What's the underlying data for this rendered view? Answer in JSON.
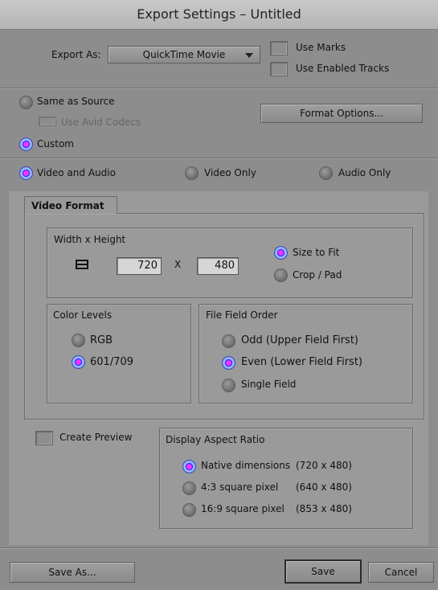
{
  "window": {
    "title": "Export Settings – Untitled"
  },
  "export": {
    "label": "Export As:",
    "format_value": "QuickTime Movie",
    "use_marks": "Use Marks",
    "use_enabled_tracks": "Use Enabled Tracks"
  },
  "source": {
    "same_as_source": "Same as Source",
    "use_avid_codecs": "Use Avid Codecs",
    "custom": "Custom",
    "format_options_button": "Format Options..."
  },
  "media_type": {
    "video_and_audio": "Video and Audio",
    "video_only": "Video Only",
    "audio_only": "Audio Only"
  },
  "tabs": {
    "video_format": "Video Format"
  },
  "size": {
    "section_title": "Width x Height",
    "width": "720",
    "x_label": "X",
    "height": "480",
    "size_to_fit": "Size to Fit",
    "crop_pad": "Crop / Pad"
  },
  "color_levels": {
    "title": "Color Levels",
    "rgb": "RGB",
    "601_709": "601/709"
  },
  "field_order": {
    "title": "File Field Order",
    "odd": "Odd (Upper Field First)",
    "even": "Even (Lower Field First)",
    "single": "Single Field"
  },
  "preview": {
    "create_preview": "Create Preview"
  },
  "aspect": {
    "title": "Display Aspect Ratio",
    "native": "Native dimensions",
    "native_dims": "(720 x 480)",
    "four_three": "4:3 square pixel",
    "four_three_dims": "(640 x 480)",
    "sixteen_nine": "16:9 square pixel",
    "sixteen_nine_dims": "(853 x 480)"
  },
  "footer": {
    "save_as": "Save As...",
    "save": "Save",
    "cancel": "Cancel"
  },
  "state": {
    "custom_selected": true,
    "media_type_selected": "video_and_audio",
    "size_mode_selected": "size_to_fit",
    "color_level_selected": "601/709",
    "field_order_selected": "even",
    "aspect_selected": "native"
  }
}
